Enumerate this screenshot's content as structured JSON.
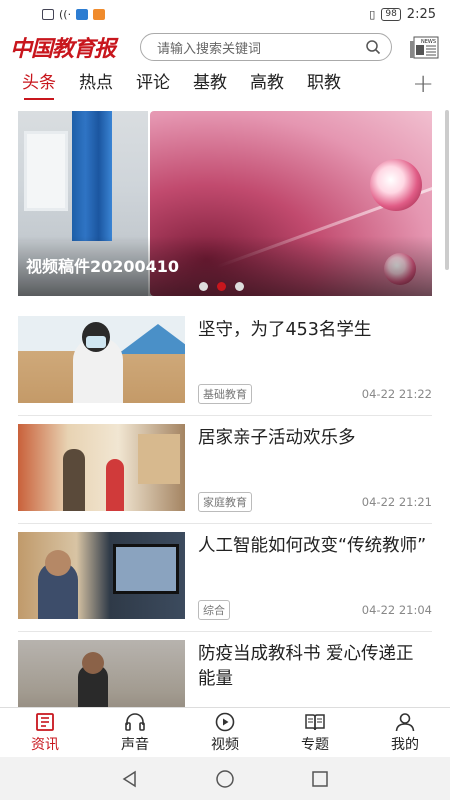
{
  "status_bar": {
    "battery": "98",
    "time": "2:25"
  },
  "header": {
    "logo_text": "中国教育报",
    "search_placeholder": "请输入搜索关键词",
    "news_icon_label": "NEWS"
  },
  "tabs": [
    {
      "label": "头条",
      "active": true
    },
    {
      "label": "热点",
      "active": false
    },
    {
      "label": "评论",
      "active": false
    },
    {
      "label": "基教",
      "active": false
    },
    {
      "label": "高教",
      "active": false
    },
    {
      "label": "职教",
      "active": false
    }
  ],
  "tab_add": "+",
  "carousel": {
    "title": "视频稿件20200410",
    "active_index": 1,
    "count": 3
  },
  "news": [
    {
      "title": "坚守，为了453名学生",
      "tag": "基础教育",
      "time": "04-22 21:22"
    },
    {
      "title": "居家亲子活动欢乐多",
      "tag": "家庭教育",
      "time": "04-22 21:21"
    },
    {
      "title": "人工智能如何改变“传统教师”",
      "tag": "综合",
      "time": "04-22 21:04"
    },
    {
      "title": "防疫当成教科书 爱心传递正能量",
      "tag": "",
      "time": ""
    }
  ],
  "bottom_nav": [
    {
      "label": "资讯",
      "icon": "news-icon",
      "active": true
    },
    {
      "label": "声音",
      "icon": "headphones-icon",
      "active": false
    },
    {
      "label": "视频",
      "icon": "play-icon",
      "active": false
    },
    {
      "label": "专题",
      "icon": "book-icon",
      "active": false
    },
    {
      "label": "我的",
      "icon": "user-icon",
      "active": false
    }
  ],
  "colors": {
    "accent": "#c8161d"
  }
}
